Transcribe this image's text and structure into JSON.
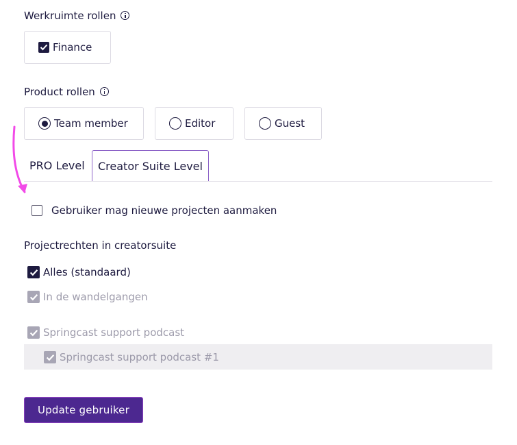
{
  "workspace_roles": {
    "title": "Werkruimte rollen",
    "options": [
      {
        "label": "Finance",
        "checked": true
      }
    ]
  },
  "product_roles": {
    "title": "Product rollen",
    "options": [
      {
        "label": "Team member",
        "selected": true
      },
      {
        "label": "Editor",
        "selected": false
      },
      {
        "label": "Guest",
        "selected": false
      }
    ]
  },
  "tabs": [
    {
      "label": "PRO Level",
      "active": false
    },
    {
      "label": "Creator Suite Level",
      "active": true
    }
  ],
  "create_projects": {
    "label": "Gebruiker mag nieuwe projecten aanmaken",
    "checked": false
  },
  "project_rights": {
    "title": "Projectrechten in creatorsuite",
    "items": [
      {
        "label": "Alles (standaard)",
        "checked": true,
        "disabled": false
      },
      {
        "label": "In de wandelgangen",
        "checked": true,
        "disabled": true
      },
      {
        "label": "Springcast support podcast",
        "checked": true,
        "disabled": true
      },
      {
        "label": "Springcast support podcast #1",
        "checked": true,
        "disabled": true
      }
    ]
  },
  "update_button": {
    "label": "Update gebruiker"
  },
  "colors": {
    "text": "#1d1a3f",
    "muted": "#9c9aaa",
    "button_bg": "#4c2890",
    "tab_border": "#8b61c7",
    "arrow": "#f24ae8"
  }
}
